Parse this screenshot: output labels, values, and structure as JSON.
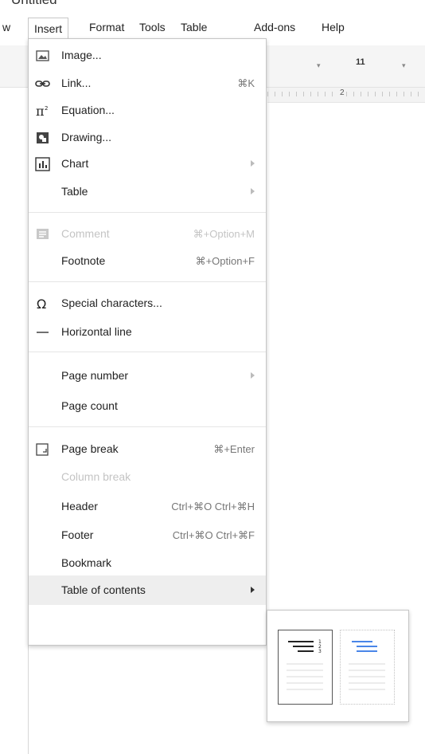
{
  "app": {
    "title_partial": "Untitled"
  },
  "menubar": {
    "items": [
      "w",
      "Insert",
      "Format",
      "Tools",
      "Table",
      "Add-ons",
      "Help"
    ]
  },
  "toolbar": {
    "font_size": "11",
    "ruler_mark": "2"
  },
  "insert_menu": {
    "image": {
      "label": "Image...",
      "icon": "image-icon"
    },
    "link": {
      "label": "Link...",
      "shortcut": "⌘K",
      "icon": "link-icon"
    },
    "equation": {
      "label": "Equation...",
      "icon": "equation-icon"
    },
    "drawing": {
      "label": "Drawing...",
      "icon": "drawing-icon"
    },
    "chart": {
      "label": "Chart",
      "icon": "chart-icon"
    },
    "table": {
      "label": "Table"
    },
    "comment": {
      "label": "Comment",
      "shortcut": "⌘+Option+M",
      "icon": "comment-icon",
      "disabled": true
    },
    "footnote": {
      "label": "Footnote",
      "shortcut": "⌘+Option+F"
    },
    "special_chars": {
      "label": "Special characters...",
      "icon": "omega-icon"
    },
    "horizontal_line": {
      "label": "Horizontal line",
      "icon": "horizontal-line-icon"
    },
    "page_number": {
      "label": "Page number"
    },
    "page_count": {
      "label": "Page count"
    },
    "page_break": {
      "label": "Page break",
      "shortcut": "⌘+Enter",
      "icon": "page-break-icon"
    },
    "column_break": {
      "label": "Column break",
      "disabled": true
    },
    "header": {
      "label": "Header",
      "shortcut": "Ctrl+⌘O Ctrl+⌘H"
    },
    "footer": {
      "label": "Footer",
      "shortcut": "Ctrl+⌘O Ctrl+⌘F"
    },
    "bookmark": {
      "label": "Bookmark"
    },
    "toc": {
      "label": "Table of contents",
      "highlighted": true
    }
  },
  "toc_submenu": {
    "options": [
      {
        "name": "toc-with-page-numbers",
        "numbers": [
          "1",
          "2",
          "3"
        ],
        "accent": "#222222"
      },
      {
        "name": "toc-with-blue-links",
        "accent": "#4a86e8"
      }
    ]
  },
  "colors": {
    "accent_blue": "#4a86e8",
    "highlight": "#eeeeee",
    "disabled": "#c4c4c4"
  }
}
